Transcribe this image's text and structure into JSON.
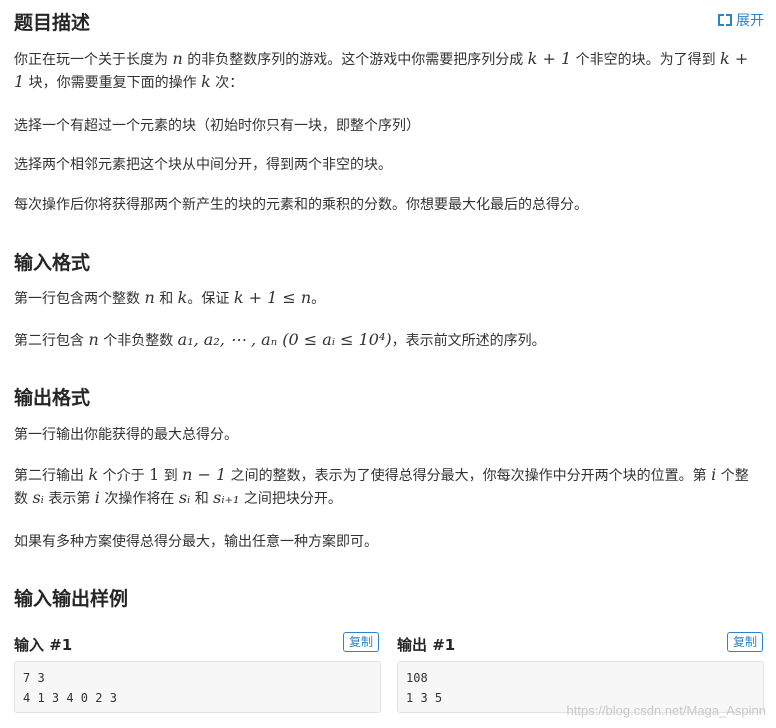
{
  "desc": {
    "title": "题目描述",
    "expand_label": "展开",
    "p1_a": "你正在玩一个关于长度为 ",
    "p1_n": "n",
    "p1_b": " 的非负整数序列的游戏。这个游戏中你需要把序列分成 ",
    "p1_k": "k + 1",
    "p1_c": " 个非空的块。为了得到 ",
    "p1_k2": "k + 1",
    "p1_d": " 块，你需要重复下面的操作 ",
    "p1_k3": "k",
    "p1_e": " 次：",
    "p2": "选择一个有超过一个元素的块（初始时你只有一块，即整个序列）",
    "p3": "选择两个相邻元素把这个块从中间分开，得到两个非空的块。",
    "p4": "每次操作后你将获得那两个新产生的块的元素和的乘积的分数。你想要最大化最后的总得分。"
  },
  "input_format": {
    "title": "输入格式",
    "l1_a": "第一行包含两个整数 ",
    "l1_n": "n",
    "l1_b": " 和 ",
    "l1_k": "k",
    "l1_c": "。保证 ",
    "l1_cond": "k + 1 ≤ n",
    "l1_d": "。",
    "l2_a": "第二行包含 ",
    "l2_n": "n",
    "l2_b": " 个非负整数 ",
    "l2_seq": "a₁, a₂, ⋯ , aₙ (0 ≤ aᵢ ≤ 10⁴)",
    "l2_c": "，表示前文所述的序列。"
  },
  "output_format": {
    "title": "输出格式",
    "l1": "第一行输出你能获得的最大总得分。",
    "l2_a": "第二行输出 ",
    "l2_k": "k",
    "l2_b": " 个介于 ",
    "l2_one": "1",
    "l2_c": " 到 ",
    "l2_nm1": "n − 1",
    "l2_d": " 之间的整数，表示为了使得总得分最大，你每次操作中分开两个块的位置。第 ",
    "l2_i": "i",
    "l2_e": " 个整数 ",
    "l2_si": "sᵢ",
    "l2_f": " 表示第 ",
    "l2_i2": "i",
    "l2_g": " 次操作将在 ",
    "l2_si2": "sᵢ",
    "l2_h": " 和 ",
    "l2_si1": "sᵢ₊₁",
    "l2_j": " 之间把块分开。",
    "l3": "如果有多种方案使得总得分最大，输出任意一种方案即可。"
  },
  "samples": {
    "title": "输入输出样例",
    "input_title": "输入 #1",
    "output_title": "输出 #1",
    "copy_label": "复制",
    "input_text": "7 3\n4 1 3 4 0 2 3",
    "output_text": "108\n1 3 5"
  },
  "watermark": "https://blog.csdn.net/Maga_Aspinn",
  "colors": {
    "accent": "#2b83c9",
    "text": "#333333"
  }
}
